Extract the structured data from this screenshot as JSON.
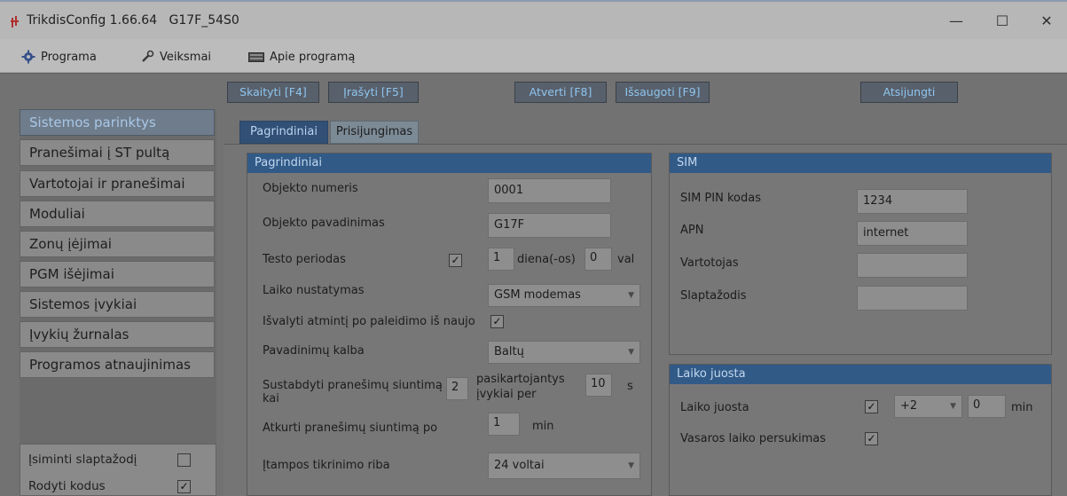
{
  "window": {
    "title": "TrikdisConfig 1.66.64   G17F_54S0",
    "minimize": "—",
    "maximize": "☐",
    "close": "✕"
  },
  "menu": {
    "items": [
      {
        "label": "Programa",
        "icon": "gear-icon"
      },
      {
        "label": "Veiksmai",
        "icon": "wrench-icon"
      },
      {
        "label": "Apie programą",
        "icon": "keyboard-icon"
      }
    ]
  },
  "toolbar": {
    "read": "Skaityti [F4]",
    "write": "Įrašyti [F5]",
    "open": "Atverti [F8]",
    "save": "Išsaugoti [F9]",
    "disconnect": "Atsijungti"
  },
  "nav": {
    "items": [
      "Sistemos parinktys",
      "Pranešimai į ST pultą",
      "Vartotojai ir pranešimai",
      "Moduliai",
      "Zonų įėjimai",
      "PGM išėjimai",
      "Sistemos įvykiai",
      "Įvykių žurnalas",
      "Programos atnaujinimas"
    ],
    "active_index": 0,
    "remember_password": {
      "label": "Įsiminti slaptažodį",
      "checked": false
    },
    "show_codes": {
      "label": "Rodyti kodus",
      "checked": true
    }
  },
  "tabs": {
    "basic": "Pagrindiniai",
    "connection": "Prisijungimas"
  },
  "basic_group": {
    "header": "Pagrindiniai",
    "object_number": {
      "label": "Objekto numeris",
      "value": "0001"
    },
    "object_name": {
      "label": "Objekto pavadinimas",
      "value": "G17F"
    },
    "test_period": {
      "label": "Testo periodas",
      "checked": true,
      "days": "1",
      "days_unit": "diena(-os)",
      "hours": "0",
      "hours_unit": "val"
    },
    "time_setting": {
      "label": "Laiko nustatymas",
      "value": "GSM modemas"
    },
    "clear_memory": {
      "label": "Išvalyti atmintį po paleidimo iš naujo",
      "checked": true
    },
    "names_language": {
      "label": "Pavadinimų kalba",
      "value": "Baltų"
    },
    "stop_sending": {
      "label_line1": "Sustabdyti pranešimų siuntimą",
      "label_line2": "kai",
      "count": "2",
      "repeating_line1": "pasikartojantys",
      "repeating_line2": "įvykiai per",
      "seconds": "10",
      "seconds_unit": "s"
    },
    "resume_sending": {
      "label": "Atkurti pranešimų siuntimą po",
      "value": "1",
      "unit": "min"
    },
    "voltage_threshold": {
      "label": "Įtampos tikrinimo riba",
      "value": "24 voltai"
    }
  },
  "sim_group": {
    "header": "SIM",
    "pin": {
      "label": "SIM PIN kodas",
      "value": "1234"
    },
    "apn": {
      "label": "APN",
      "value": "internet"
    },
    "user": {
      "label": "Vartotojas",
      "value": ""
    },
    "password": {
      "label": "Slaptažodis",
      "value": ""
    }
  },
  "timezone_group": {
    "header": "Laiko juosta",
    "timezone": {
      "label": "Laiko juosta",
      "checked": true,
      "offset": "+2",
      "minutes": "0",
      "minutes_unit": "min"
    },
    "dst": {
      "label": "Vasaros laiko persukimas",
      "checked": true
    }
  }
}
